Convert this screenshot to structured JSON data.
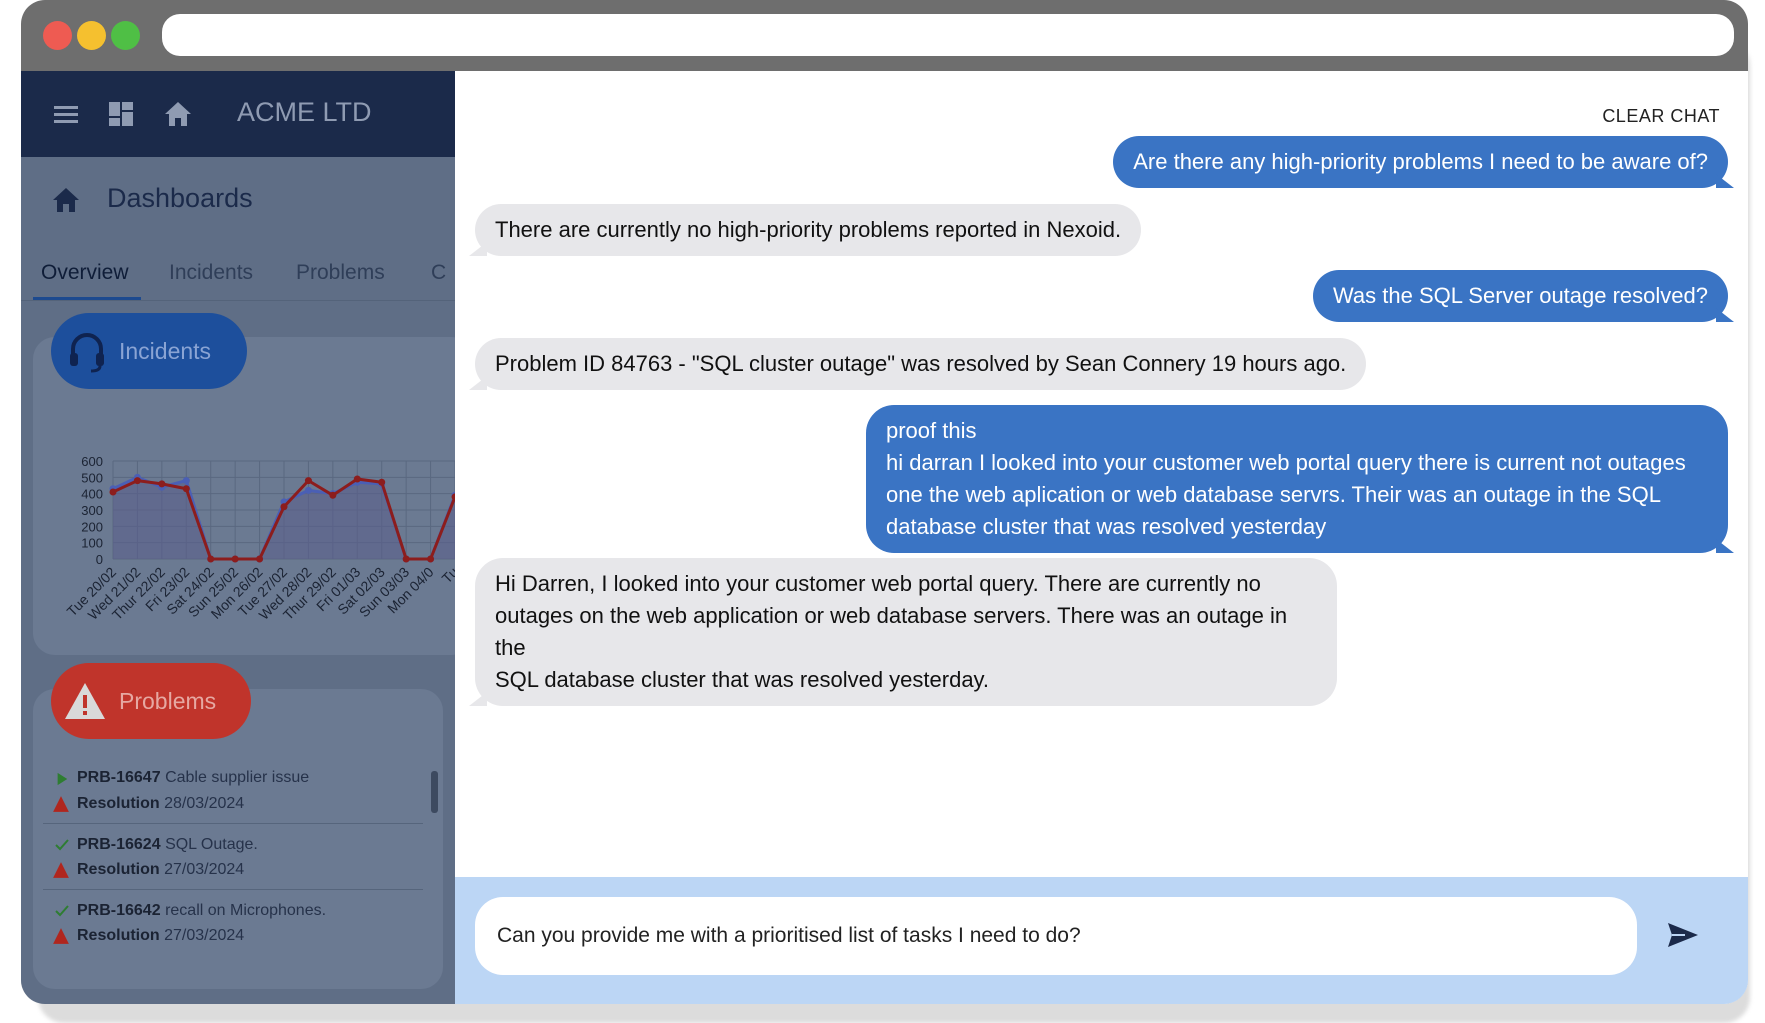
{
  "app": {
    "brand": "ACME LTD",
    "page_title": "Dashboards",
    "tabs": [
      {
        "label": "Overview",
        "active": true
      },
      {
        "label": "Incidents",
        "active": false
      },
      {
        "label": "Problems",
        "active": false
      },
      {
        "label": "C",
        "active": false
      }
    ],
    "incidents_card": {
      "label": "Incidents",
      "color": "#1d4f9c"
    },
    "problems_card": {
      "label": "Problems",
      "color": "#c0342b"
    },
    "problems": [
      {
        "id": "PRB-16647",
        "title": "Cable supplier issue",
        "status_icon": "play-icon",
        "resolution_label": "Resolution",
        "resolution_date": "28/03/2024"
      },
      {
        "id": "PRB-16624",
        "title": "SQL Outage.",
        "status_icon": "check-icon",
        "resolution_label": "Resolution",
        "resolution_date": "27/03/2024"
      },
      {
        "id": "PRB-16642",
        "title": "recall on Microphones.",
        "status_icon": "check-icon",
        "resolution_label": "Resolution",
        "resolution_date": "27/03/2024"
      }
    ]
  },
  "chart_data": {
    "type": "area",
    "categories": [
      "Tue 20/02",
      "Wed 21/02",
      "Thur 22/02",
      "Fri 23/02",
      "Sat 24/02",
      "Sun 25/02",
      "Mon 26/02",
      "Tue 27/02",
      "Wed 28/02",
      "Thur 29/02",
      "Fri 01/03",
      "Sat 02/03",
      "Sun 03/03",
      "Mon 04/0",
      "Tu"
    ],
    "yticks": [
      "600",
      "500",
      "400",
      "300",
      "200",
      "100",
      "0"
    ],
    "ylim": [
      0,
      600
    ],
    "series": [
      {
        "color": "#4a5fb5",
        "values": [
          430,
          500,
          440,
          480,
          0,
          0,
          0,
          350,
          420,
          400,
          470,
          460,
          0,
          0,
          390
        ]
      },
      {
        "color": "#8c1d1d",
        "values": [
          410,
          480,
          460,
          430,
          0,
          0,
          0,
          320,
          480,
          390,
          490,
          470,
          0,
          0,
          380
        ]
      }
    ],
    "grid": true
  },
  "chat": {
    "clear_label": "CLEAR CHAT",
    "messages": [
      {
        "role": "user",
        "text": "Are there any high-priority problems I need to be aware of?"
      },
      {
        "role": "bot",
        "text": "There are currently no high-priority problems reported in Nexoid."
      },
      {
        "role": "user",
        "text": "Was the SQL Server outage resolved?"
      },
      {
        "role": "bot",
        "text": "Problem ID 84763 - \"SQL cluster outage\" was resolved by Sean Connery 19 hours ago."
      },
      {
        "role": "user",
        "lines": [
          "proof this",
          "hi darran I looked into your customer web portal query there is current not outages",
          "one the web aplication or web database servrs. Their was an outage in the SQL",
          "database cluster that was resolved yesterday"
        ]
      },
      {
        "role": "bot",
        "lines": [
          "Hi Darren, I looked into your customer web portal query. There are currently no",
          "outages on the web application or web database servers. There was an outage in the",
          "SQL database cluster that was resolved yesterday."
        ]
      }
    ],
    "input_value": "Can you provide me with a prioritised list of tasks I need to do?"
  }
}
